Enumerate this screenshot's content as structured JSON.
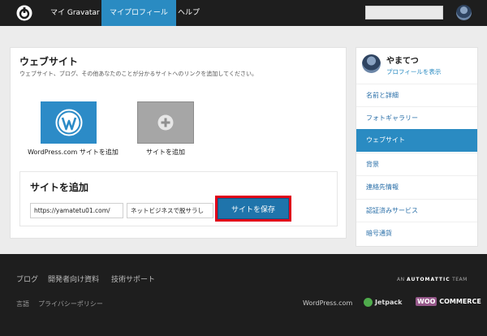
{
  "topnav": {
    "items": [
      "マイ Gravatar",
      "マイプロフィール",
      "ヘルプ"
    ],
    "active_index": 1
  },
  "main": {
    "title": "ウェブサイト",
    "description": "ウェブサイト、ブログ、その他あなたのことが分かるサイトへのリンクを追加してください。",
    "options": [
      {
        "label": "WordPress.com サイトを追加",
        "icon": "wordpress-icon"
      },
      {
        "label": "サイトを追加",
        "icon": "plus-icon"
      }
    ],
    "add_site": {
      "title": "サイトを追加",
      "url_value": "https://yamatetu01.com/",
      "name_value": "ネットビジネスで脱サラし",
      "save_label": "サイトを保存"
    }
  },
  "sidebar": {
    "user_name": "やまてつ",
    "view_profile": "プロフィールを表示",
    "items": [
      "名前と詳細",
      "フォトギャラリー",
      "ウェブサイト",
      "背景",
      "連絡先情報",
      "認証済みサービス",
      "暗号通貨"
    ],
    "active_index": 2
  },
  "footer": {
    "links": [
      "ブログ",
      "開発者向け資料",
      "技術サポート"
    ],
    "small_links": [
      "言語",
      "プライバシーポリシー"
    ],
    "automattic_prefix": "AN",
    "automattic_name": "AUTOMATTIC",
    "automattic_suffix": "TEAM",
    "brands": {
      "wpcom": "WordPress.com",
      "jetpack": "Jetpack",
      "woo_1": "WOO",
      "woo_2": "COMMERCE"
    }
  },
  "colors": {
    "accent": "#2a8bc2",
    "highlight": "#e0001a",
    "dark": "#1e1e1e"
  }
}
